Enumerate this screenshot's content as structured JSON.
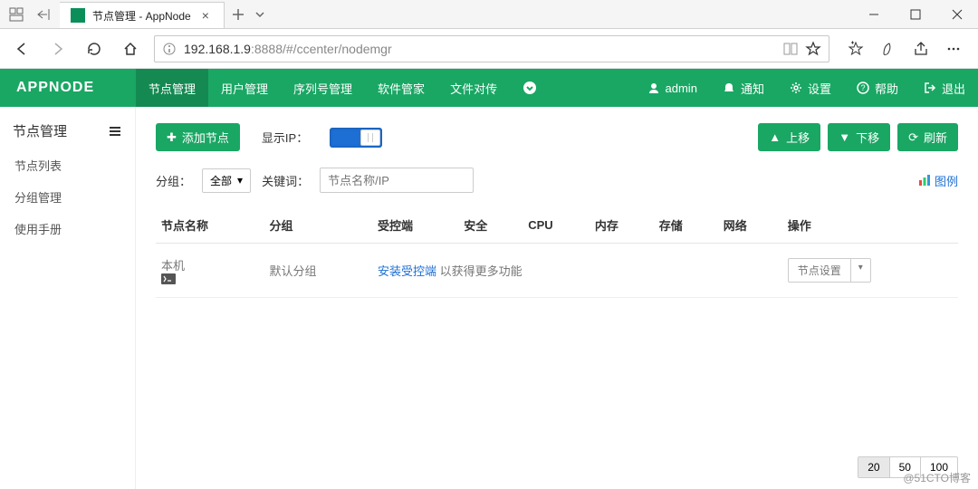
{
  "window": {
    "tab_title": "节点管理 - AppNode",
    "url_host": "192.168.1.9",
    "url_rest": ":8888/#/ccenter/nodemgr"
  },
  "topnav": {
    "logo": "APPNODE",
    "items": [
      "节点管理",
      "用户管理",
      "序列号管理",
      "软件管家",
      "文件对传"
    ],
    "right": {
      "user": "admin",
      "notify": "通知",
      "settings": "设置",
      "help": "帮助",
      "logout": "退出"
    }
  },
  "sidebar": {
    "title": "节点管理",
    "items": [
      "节点列表",
      "分组管理",
      "使用手册"
    ]
  },
  "toolbar": {
    "add_node": "添加节点",
    "show_ip": "显示IP：",
    "up": "上移",
    "down": "下移",
    "refresh": "刷新",
    "group_label": "分组：",
    "group_value": "全部",
    "keyword_label": "关键词：",
    "keyword_placeholder": "节点名称/IP",
    "legend": "图例"
  },
  "table": {
    "headers": [
      "节点名称",
      "分组",
      "受控端",
      "安全",
      "CPU",
      "内存",
      "存储",
      "网络",
      "操作"
    ],
    "rows": [
      {
        "name": "本机",
        "group": "默认分组",
        "controlled_link": "安装受控端",
        "controlled_tail": " 以获得更多功能",
        "op": "节点设置"
      }
    ]
  },
  "pager": {
    "options": [
      "20",
      "50",
      "100"
    ],
    "active": "20"
  },
  "watermark": "@51CTO博客"
}
